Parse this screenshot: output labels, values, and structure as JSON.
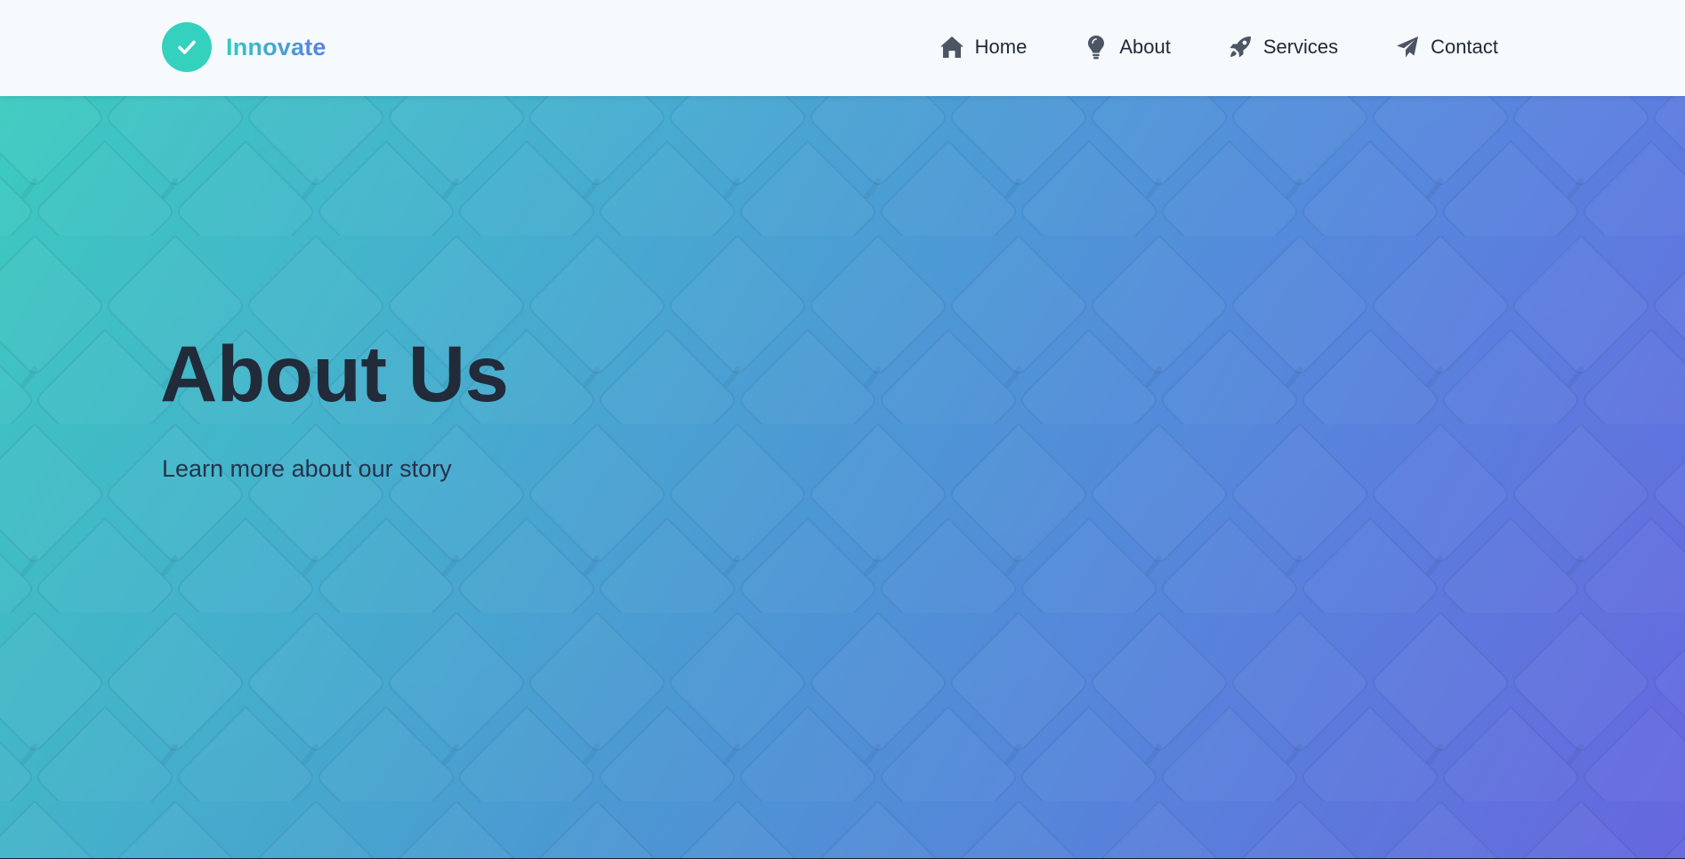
{
  "brand": {
    "name": "Innovate",
    "logo_icon": "checkmark-icon",
    "logo_color": "#34d1bf"
  },
  "nav": {
    "items": [
      {
        "label": "Home",
        "icon": "home-icon"
      },
      {
        "label": "About",
        "icon": "lightbulb-icon"
      },
      {
        "label": "Services",
        "icon": "rocket-icon"
      },
      {
        "label": "Contact",
        "icon": "paper-plane-icon"
      }
    ]
  },
  "hero": {
    "title": "About Us",
    "subtitle": "Learn more about our story",
    "gradient_start": "#3ccabf",
    "gradient_end": "#6a6be8"
  },
  "colors": {
    "text_dark": "#1f2937",
    "navbar_bg": "#f6fafc"
  }
}
